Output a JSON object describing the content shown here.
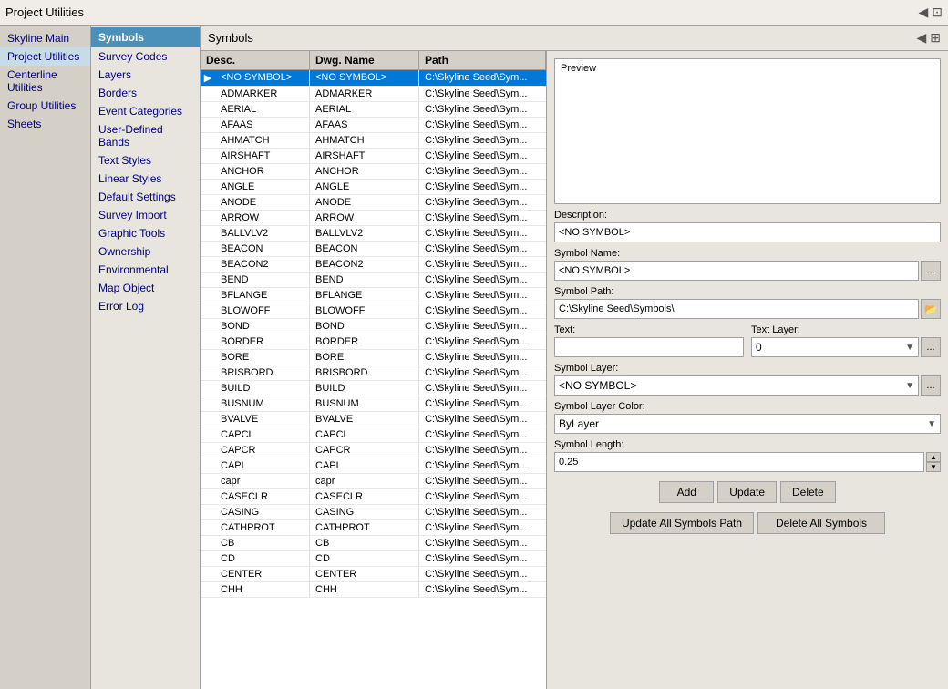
{
  "topbar": {
    "title": "Project Utilities",
    "back_icon": "◀",
    "dock_icon": "⊡"
  },
  "sidebar": {
    "items": [
      {
        "id": "skyline-main",
        "label": "Skyline Main"
      },
      {
        "id": "project-utilities",
        "label": "Project Utilities"
      },
      {
        "id": "centerline-utilities",
        "label": "Centerline Utilities"
      },
      {
        "id": "group-utilities",
        "label": "Group Utilities"
      },
      {
        "id": "sheets",
        "label": "Sheets"
      }
    ]
  },
  "middle": {
    "active_tab": "Symbols",
    "items": [
      {
        "id": "symbols",
        "label": "Symbols"
      },
      {
        "id": "survey-codes",
        "label": "Survey Codes"
      },
      {
        "id": "layers",
        "label": "Layers"
      },
      {
        "id": "borders",
        "label": "Borders"
      },
      {
        "id": "event-categories",
        "label": "Event Categories"
      },
      {
        "id": "user-defined-bands",
        "label": "User-Defined Bands"
      },
      {
        "id": "text-styles",
        "label": "Text Styles"
      },
      {
        "id": "linear-styles",
        "label": "Linear Styles"
      },
      {
        "id": "default-settings",
        "label": "Default Settings"
      },
      {
        "id": "survey-import",
        "label": "Survey Import"
      },
      {
        "id": "graphic-tools",
        "label": "Graphic Tools"
      },
      {
        "id": "ownership",
        "label": "Ownership"
      },
      {
        "id": "environmental",
        "label": "Environmental"
      },
      {
        "id": "map-object",
        "label": "Map Object"
      },
      {
        "id": "error-log",
        "label": "Error Log"
      }
    ]
  },
  "symbols_panel": {
    "title": "Symbols",
    "back_icon": "◀",
    "dock_icon": "⊞"
  },
  "table": {
    "columns": [
      "Desc.",
      "Dwg. Name",
      "Path"
    ],
    "rows": [
      {
        "desc": "<NO SYMBOL>",
        "dwg": "<NO SYMBOL>",
        "path": "C:\\Skyline Seed\\Sym...",
        "selected": true,
        "arrow": true
      },
      {
        "desc": "ADMARKER",
        "dwg": "ADMARKER",
        "path": "C:\\Skyline Seed\\Sym..."
      },
      {
        "desc": "AERIAL",
        "dwg": "AERIAL",
        "path": "C:\\Skyline Seed\\Sym..."
      },
      {
        "desc": "AFAAS",
        "dwg": "AFAAS",
        "path": "C:\\Skyline Seed\\Sym..."
      },
      {
        "desc": "AHMATCH",
        "dwg": "AHMATCH",
        "path": "C:\\Skyline Seed\\Sym..."
      },
      {
        "desc": "AIRSHAFT",
        "dwg": "AIRSHAFT",
        "path": "C:\\Skyline Seed\\Sym..."
      },
      {
        "desc": "ANCHOR",
        "dwg": "ANCHOR",
        "path": "C:\\Skyline Seed\\Sym..."
      },
      {
        "desc": "ANGLE",
        "dwg": "ANGLE",
        "path": "C:\\Skyline Seed\\Sym..."
      },
      {
        "desc": "ANODE",
        "dwg": "ANODE",
        "path": "C:\\Skyline Seed\\Sym..."
      },
      {
        "desc": "ARROW",
        "dwg": "ARROW",
        "path": "C:\\Skyline Seed\\Sym..."
      },
      {
        "desc": "BALLVLV2",
        "dwg": "BALLVLV2",
        "path": "C:\\Skyline Seed\\Sym..."
      },
      {
        "desc": "BEACON",
        "dwg": "BEACON",
        "path": "C:\\Skyline Seed\\Sym..."
      },
      {
        "desc": "BEACON2",
        "dwg": "BEACON2",
        "path": "C:\\Skyline Seed\\Sym..."
      },
      {
        "desc": "BEND",
        "dwg": "BEND",
        "path": "C:\\Skyline Seed\\Sym..."
      },
      {
        "desc": "BFLANGE",
        "dwg": "BFLANGE",
        "path": "C:\\Skyline Seed\\Sym..."
      },
      {
        "desc": "BLOWOFF",
        "dwg": "BLOWOFF",
        "path": "C:\\Skyline Seed\\Sym..."
      },
      {
        "desc": "BOND",
        "dwg": "BOND",
        "path": "C:\\Skyline Seed\\Sym..."
      },
      {
        "desc": "BORDER",
        "dwg": "BORDER",
        "path": "C:\\Skyline Seed\\Sym..."
      },
      {
        "desc": "BORE",
        "dwg": "BORE",
        "path": "C:\\Skyline Seed\\Sym..."
      },
      {
        "desc": "BRISBORD",
        "dwg": "BRISBORD",
        "path": "C:\\Skyline Seed\\Sym..."
      },
      {
        "desc": "BUILD",
        "dwg": "BUILD",
        "path": "C:\\Skyline Seed\\Sym..."
      },
      {
        "desc": "BUSNUM",
        "dwg": "BUSNUM",
        "path": "C:\\Skyline Seed\\Sym..."
      },
      {
        "desc": "BVALVE",
        "dwg": "BVALVE",
        "path": "C:\\Skyline Seed\\Sym..."
      },
      {
        "desc": "CAPCL",
        "dwg": "CAPCL",
        "path": "C:\\Skyline Seed\\Sym..."
      },
      {
        "desc": "CAPCR",
        "dwg": "CAPCR",
        "path": "C:\\Skyline Seed\\Sym..."
      },
      {
        "desc": "CAPL",
        "dwg": "CAPL",
        "path": "C:\\Skyline Seed\\Sym..."
      },
      {
        "desc": "capr",
        "dwg": "capr",
        "path": "C:\\Skyline Seed\\Sym..."
      },
      {
        "desc": "CASECLR",
        "dwg": "CASECLR",
        "path": "C:\\Skyline Seed\\Sym..."
      },
      {
        "desc": "CASING",
        "dwg": "CASING",
        "path": "C:\\Skyline Seed\\Sym..."
      },
      {
        "desc": "CATHPROT",
        "dwg": "CATHPROT",
        "path": "C:\\Skyline Seed\\Sym..."
      },
      {
        "desc": "CB",
        "dwg": "CB",
        "path": "C:\\Skyline Seed\\Sym..."
      },
      {
        "desc": "CD",
        "dwg": "CD",
        "path": "C:\\Skyline Seed\\Sym..."
      },
      {
        "desc": "CENTER",
        "dwg": "CENTER",
        "path": "C:\\Skyline Seed\\Sym..."
      },
      {
        "desc": "CHH",
        "dwg": "CHH",
        "path": "C:\\Skyline Seed\\Sym..."
      }
    ]
  },
  "right_panel": {
    "preview_label": "Preview",
    "description_label": "Description:",
    "description_value": "<NO SYMBOL>",
    "symbol_name_label": "Symbol Name:",
    "symbol_name_value": "<NO SYMBOL>",
    "symbol_path_label": "Symbol Path:",
    "symbol_path_value": "C:\\Skyline Seed\\Symbols\\",
    "text_label": "Text:",
    "text_value": "",
    "text_layer_label": "Text Layer:",
    "text_layer_value": "0",
    "symbol_layer_label": "Symbol Layer:",
    "symbol_layer_value": "<NO SYMBOL>",
    "symbol_layer_color_label": "Symbol Layer Color:",
    "symbol_layer_color_value": "ByLayer",
    "symbol_length_label": "Symbol Length:",
    "symbol_length_value": "0.25",
    "btn_add": "Add",
    "btn_update": "Update",
    "btn_delete": "Delete",
    "btn_update_all_path": "Update All Symbols Path",
    "btn_delete_all": "Delete All Symbols",
    "dots_label": "...",
    "folder_icon": "📁"
  }
}
